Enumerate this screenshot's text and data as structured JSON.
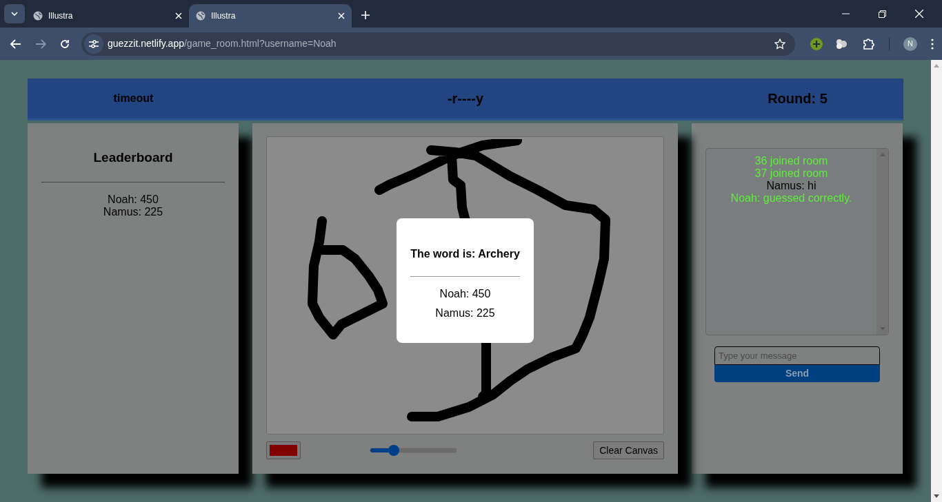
{
  "browser": {
    "tabs": [
      {
        "title": "Illustra",
        "selected": false
      },
      {
        "title": "Illustra",
        "selected": true
      }
    ],
    "address": {
      "host": "guezzit.netlify.app",
      "path": "/game_room.html?username=Noah"
    },
    "profile_initial": "N"
  },
  "header": {
    "timer": "timeout",
    "word": "-r----y",
    "round": "Round: 5"
  },
  "leaderboard": {
    "title": "Leaderboard",
    "entries": [
      "Noah: 450",
      "Namus: 225"
    ]
  },
  "canvas_tools": {
    "color": "#800000",
    "brush_size": {
      "level": 0.27
    },
    "clear_button": "Clear Canvas"
  },
  "modal": {
    "title": "The word is: Archery",
    "scores": [
      "Noah: 450",
      "Namus: 225"
    ]
  },
  "chat": {
    "messages": [
      {
        "kind": "system",
        "text": "36 joined room"
      },
      {
        "kind": "system",
        "text": "37 joined room"
      },
      {
        "kind": "user",
        "text": "Namus: hi"
      },
      {
        "kind": "system",
        "text": "Noah: guessed correctly."
      }
    ],
    "input": {
      "placeholder": "Type your message"
    },
    "send_button": "Send"
  }
}
